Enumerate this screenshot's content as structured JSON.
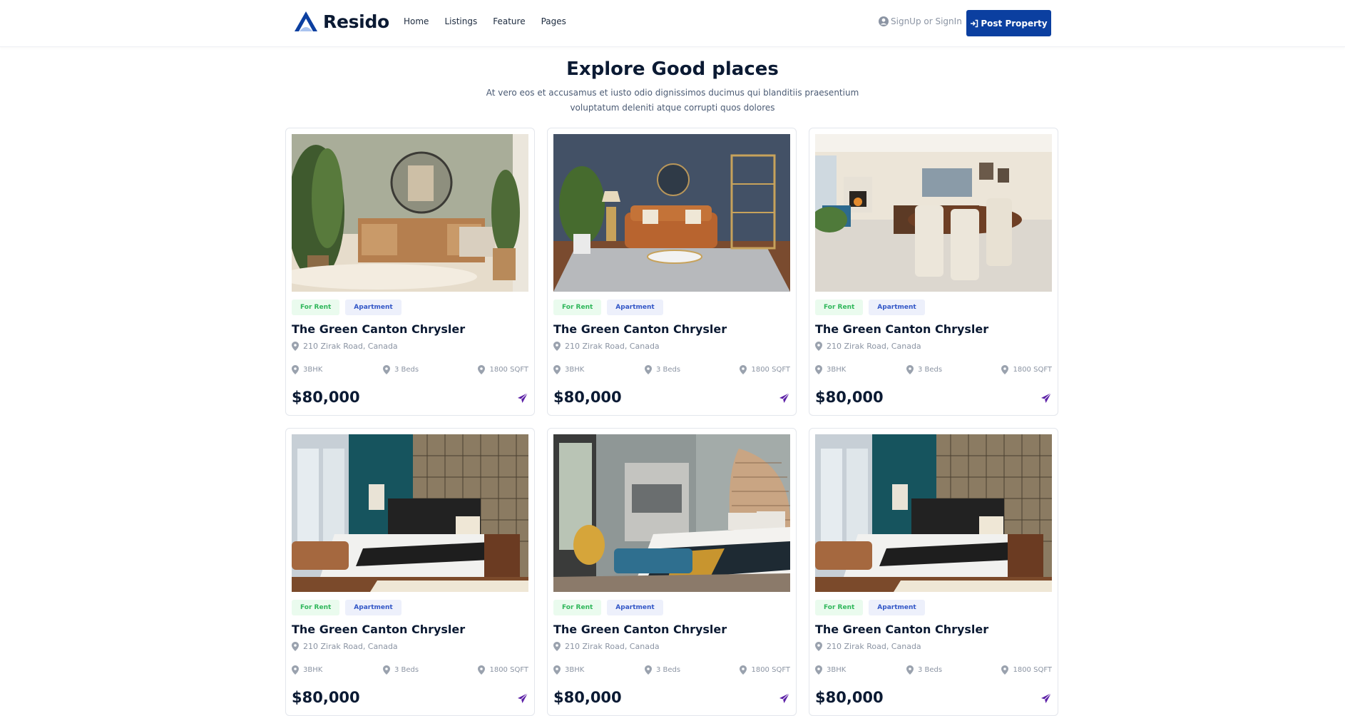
{
  "brand": {
    "name": "Resido"
  },
  "nav": [
    "Home",
    "Listings",
    "Feature",
    "Pages"
  ],
  "auth": {
    "signin_label": "SignUp or SignIn"
  },
  "cta": {
    "post_property_label": "Post Property"
  },
  "section": {
    "title": "Explore Good places",
    "subtitle": "At vero eos et accusamus et iusto odio dignissimos ducimus qui blanditiis praesentium voluptatum deleniti atque corrupti quos dolores"
  },
  "listings": [
    {
      "status": "For Rent",
      "type": "Apartment",
      "name": "The Green Canton Chrysler",
      "address": "210 Zirak Road, Canada",
      "bhk": "3BHK",
      "beds": "3 Beds",
      "area": "1800 SQFT",
      "price": "$80,000",
      "photo": "living-room-green"
    },
    {
      "status": "For Rent",
      "type": "Apartment",
      "name": "The Green Canton Chrysler",
      "address": "210 Zirak Road, Canada",
      "bhk": "3BHK",
      "beds": "3 Beds",
      "area": "1800 SQFT",
      "price": "$80,000",
      "photo": "living-room-navy"
    },
    {
      "status": "For Rent",
      "type": "Apartment",
      "name": "The Green Canton Chrysler",
      "address": "210 Zirak Road, Canada",
      "bhk": "3BHK",
      "beds": "3 Beds",
      "area": "1800 SQFT",
      "price": "$80,000",
      "photo": "dining-living-room"
    },
    {
      "status": "For Rent",
      "type": "Apartment",
      "name": "The Green Canton Chrysler",
      "address": "210 Zirak Road, Canada",
      "bhk": "3BHK",
      "beds": "3 Beds",
      "area": "1800 SQFT",
      "price": "$80,000",
      "photo": "bedroom-teal"
    },
    {
      "status": "For Rent",
      "type": "Apartment",
      "name": "The Green Canton Chrysler",
      "address": "210 Zirak Road, Canada",
      "bhk": "3BHK",
      "beds": "3 Beds",
      "area": "1800 SQFT",
      "price": "$80,000",
      "photo": "bedroom-grey"
    },
    {
      "status": "For Rent",
      "type": "Apartment",
      "name": "The Green Canton Chrysler",
      "address": "210 Zirak Road, Canada",
      "bhk": "3BHK",
      "beds": "3 Beds",
      "area": "1800 SQFT",
      "price": "$80,000",
      "photo": "bedroom-teal"
    }
  ],
  "colors": {
    "primary": "#0b3fa0",
    "heading": "#0b1a33",
    "rent_tag": "#2fb75a",
    "apartment_tag": "#3357c7",
    "send_icon": "#5b1fa6"
  },
  "icons": [
    "logo-icon",
    "user-circle-icon",
    "sign-in-icon",
    "map-pin-icon",
    "send-icon"
  ]
}
